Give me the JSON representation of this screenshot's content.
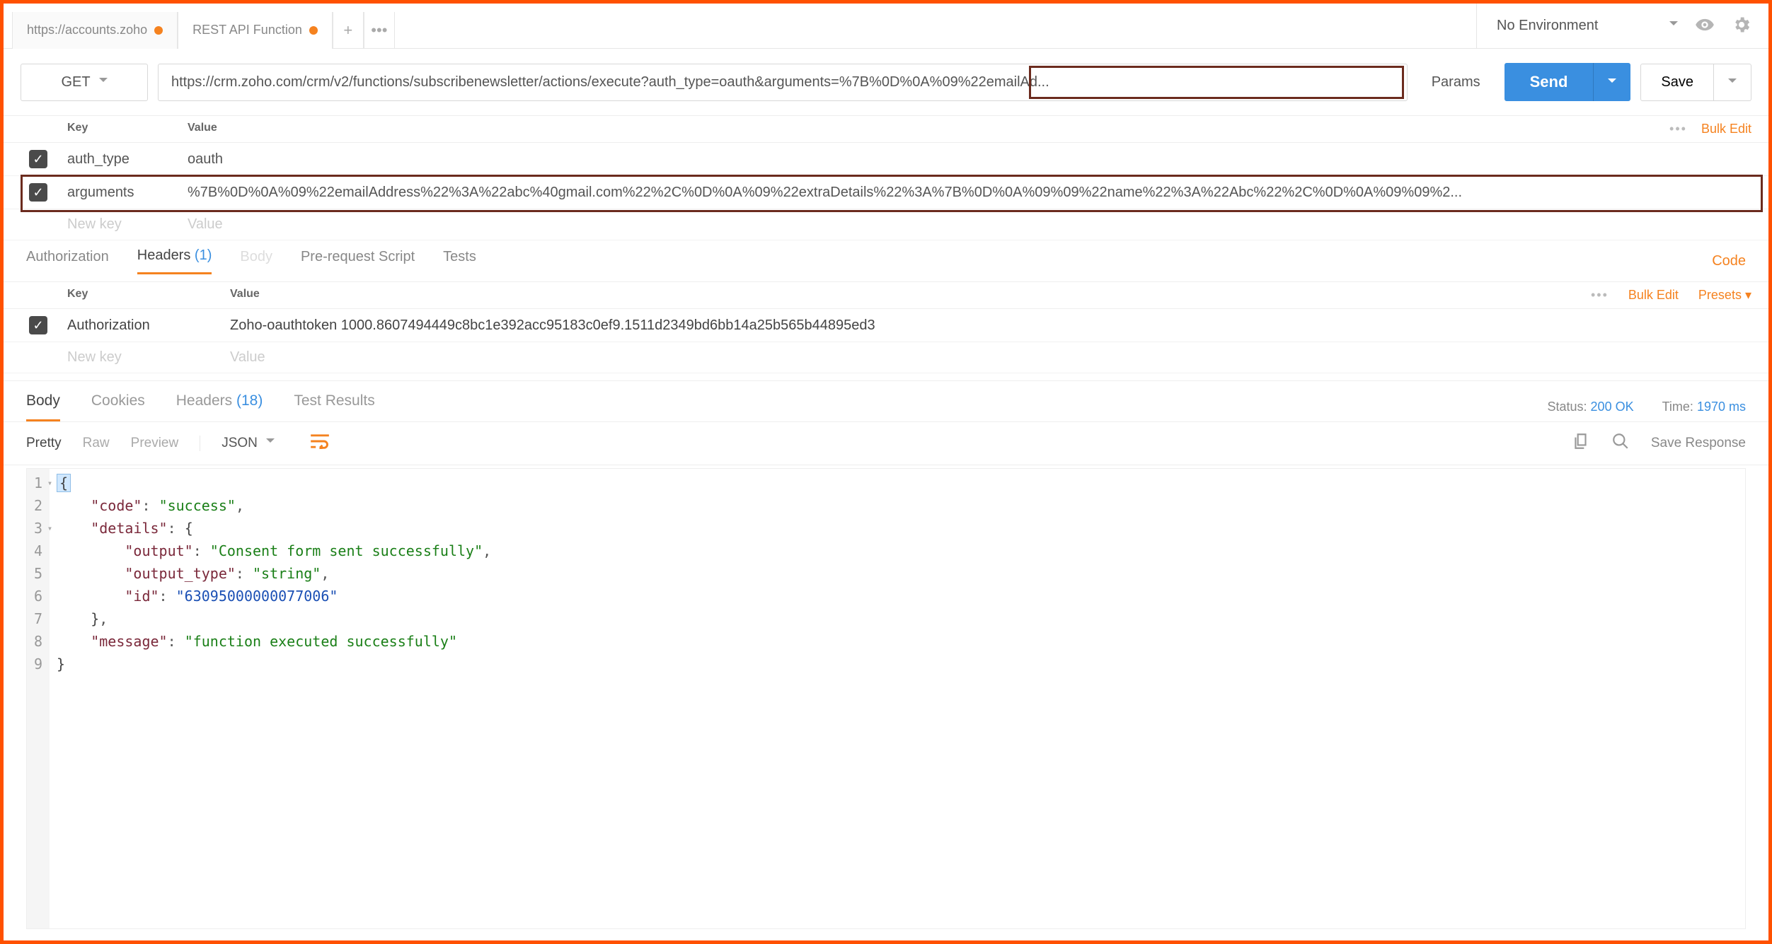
{
  "topbar": {
    "tab1_label": "https://accounts.zoho",
    "tab2_label": "REST API Function",
    "env_label": "No Environment"
  },
  "request": {
    "method": "GET",
    "url": "https://crm.zoho.com/crm/v2/functions/subscribenewsletter/actions/execute?auth_type=oauth&arguments=%7B%0D%0A%09%22emailAd...",
    "params_label": "Params",
    "send_label": "Send",
    "save_label": "Save"
  },
  "params_table": {
    "head_key": "Key",
    "head_value": "Value",
    "bulk_edit": "Bulk Edit",
    "rows": [
      {
        "key": "auth_type",
        "value": "oauth"
      },
      {
        "key": "arguments",
        "value": "%7B%0D%0A%09%22emailAddress%22%3A%22abc%40gmail.com%22%2C%0D%0A%09%22extraDetails%22%3A%7B%0D%0A%09%09%22name%22%3A%22Abc%22%2C%0D%0A%09%09%2..."
      }
    ],
    "new_key": "New key",
    "new_value": "Value"
  },
  "req_tabs": {
    "authorization": "Authorization",
    "headers": "Headers",
    "headers_count": "(1)",
    "body": "Body",
    "prerequest": "Pre-request Script",
    "tests": "Tests",
    "code": "Code"
  },
  "headers_table": {
    "head_key": "Key",
    "head_value": "Value",
    "bulk_edit": "Bulk Edit",
    "presets": "Presets",
    "rows": [
      {
        "key": "Authorization",
        "value": "Zoho-oauthtoken 1000.8607494449c8bc1e392acc95183c0ef9.1511d2349bd6bb14a25b565b44895ed3"
      }
    ],
    "new_key": "New key",
    "new_value": "Value"
  },
  "resp_tabs": {
    "body": "Body",
    "cookies": "Cookies",
    "headers": "Headers",
    "headers_count": "(18)",
    "test_results": "Test Results",
    "status_label": "Status:",
    "status_value": "200 OK",
    "time_label": "Time:",
    "time_value": "1970 ms"
  },
  "viewer": {
    "pretty": "Pretty",
    "raw": "Raw",
    "preview": "Preview",
    "format": "JSON",
    "save_response": "Save Response"
  },
  "response_body": {
    "l1": "{",
    "l2_k": "\"code\"",
    "l2_v": "\"success\"",
    "l3_k": "\"details\"",
    "l4_k": "\"output\"",
    "l4_v": "\"Consent form sent successfully\"",
    "l5_k": "\"output_type\"",
    "l5_v": "\"string\"",
    "l6_k": "\"id\"",
    "l6_v": "\"63095000000077006\"",
    "l8_k": "\"message\"",
    "l8_v": "\"function executed successfully\"",
    "line_nums": [
      "1",
      "2",
      "3",
      "4",
      "5",
      "6",
      "7",
      "8",
      "9"
    ]
  }
}
